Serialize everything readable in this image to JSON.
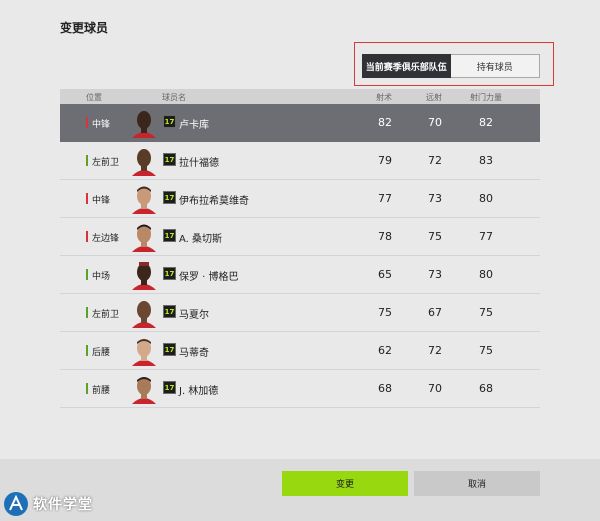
{
  "dialog": {
    "title": "变更球员"
  },
  "toggle": {
    "current_club": "当前赛季俱乐部队伍",
    "owned": "持有球员"
  },
  "colors": {
    "forward": "#d8343a",
    "midfield": "#5aa32a",
    "badge_text": "#b8f01c",
    "confirm": "#98d80f",
    "highlight": "#d83a3a"
  },
  "columns": {
    "position": "位置",
    "name": "球员名",
    "shooting": "射术",
    "long_shot": "远射",
    "shot_power": "射门力量"
  },
  "players": [
    {
      "position": "中锋",
      "badge": "17",
      "name": "卢卡库",
      "shooting": "82",
      "long_shot": "70",
      "shot_power": "82",
      "role": "forward"
    },
    {
      "position": "左前卫",
      "badge": "17",
      "name": "拉什福德",
      "shooting": "79",
      "long_shot": "72",
      "shot_power": "83",
      "role": "midfield"
    },
    {
      "position": "中锋",
      "badge": "17",
      "name": "伊布拉希莫维奇",
      "shooting": "77",
      "long_shot": "73",
      "shot_power": "80",
      "role": "forward"
    },
    {
      "position": "左边锋",
      "badge": "17",
      "name": "A. 桑切斯",
      "shooting": "78",
      "long_shot": "75",
      "shot_power": "77",
      "role": "forward"
    },
    {
      "position": "中场",
      "badge": "17",
      "name": "保罗 · 博格巴",
      "shooting": "65",
      "long_shot": "73",
      "shot_power": "80",
      "role": "midfield"
    },
    {
      "position": "左前卫",
      "badge": "17",
      "name": "马夏尔",
      "shooting": "75",
      "long_shot": "67",
      "shot_power": "75",
      "role": "midfield"
    },
    {
      "position": "后腰",
      "badge": "17",
      "name": "马蒂奇",
      "shooting": "62",
      "long_shot": "72",
      "shot_power": "75",
      "role": "midfield"
    },
    {
      "position": "前腰",
      "badge": "17",
      "name": "J. 林加德",
      "shooting": "68",
      "long_shot": "70",
      "shot_power": "68",
      "role": "midfield"
    }
  ],
  "buttons": {
    "confirm": "变更",
    "cancel": "取消"
  },
  "watermark": {
    "text": "软件学堂"
  }
}
